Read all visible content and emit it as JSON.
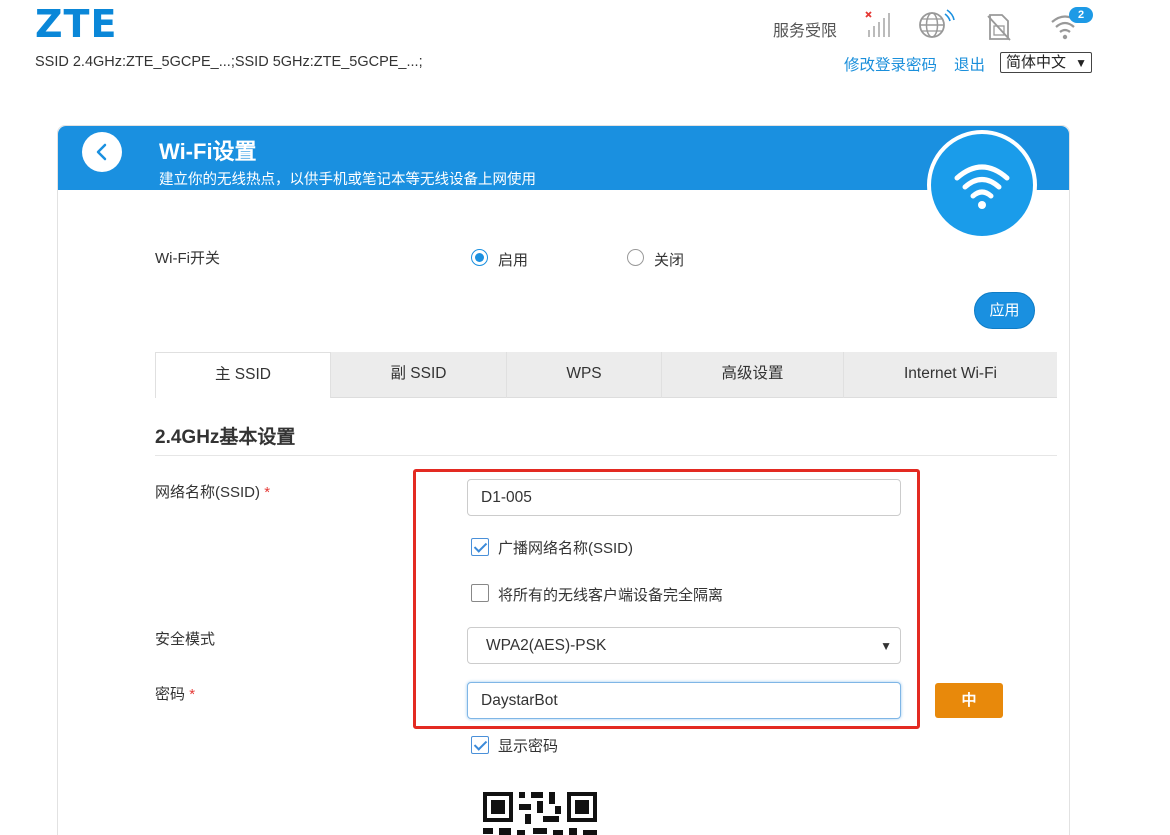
{
  "header": {
    "logo": "ZTE",
    "ssid_info": "SSID 2.4GHz:ZTE_5GCPE_...;SSID 5GHz:ZTE_5GCPE_...;",
    "service_status": "服务受限",
    "wifi_clients_badge": "2",
    "change_password_link": "修改登录密码",
    "logout_link": "退出",
    "language": "简体中文"
  },
  "page": {
    "title": "Wi-Fi设置",
    "subtitle": "建立你的无线热点，以供手机或笔记本等无线设备上网使用"
  },
  "wifi_switch": {
    "label": "Wi-Fi开关",
    "enable_label": "启用",
    "disable_label": "关闭",
    "selected": "启用",
    "apply_label": "应用"
  },
  "tabs": [
    {
      "label": "主 SSID",
      "active": true
    },
    {
      "label": "副 SSID",
      "active": false
    },
    {
      "label": "WPS",
      "active": false
    },
    {
      "label": "高级设置",
      "active": false
    },
    {
      "label": "Internet Wi-Fi",
      "active": false
    }
  ],
  "section": {
    "title": "2.4GHz基本设置"
  },
  "form": {
    "ssid_label": "网络名称(SSID)",
    "required_mark": "*",
    "ssid_value": "D1-005",
    "broadcast_label": "广播网络名称(SSID)",
    "broadcast_checked": true,
    "isolate_label": "将所有的无线客户端设备完全隔离",
    "isolate_checked": false,
    "security_label": "安全模式",
    "security_value": "WPA2(AES)-PSK",
    "password_label": "密码",
    "password_value": "DaystarBot",
    "password_strength": "中",
    "show_password_label": "显示密码",
    "show_password_checked": true
  },
  "colors": {
    "brand": "#1a90e0",
    "highlight_box": "#e32a22",
    "strength_medium": "#e8890b"
  }
}
